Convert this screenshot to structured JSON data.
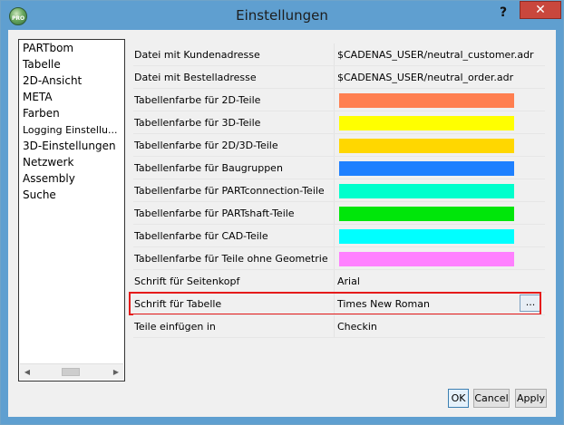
{
  "window": {
    "title": "Einstellungen",
    "help_label": "?",
    "close_label": "✕",
    "icon_text": "PRO"
  },
  "nav": {
    "items": [
      {
        "label": "PARTbom"
      },
      {
        "label": "Tabelle"
      },
      {
        "label": "2D-Ansicht"
      },
      {
        "label": "META"
      },
      {
        "label": "Farben"
      },
      {
        "label": "Logging Einstellu..."
      },
      {
        "label": "3D-Einstellungen"
      },
      {
        "label": "Netzwerk"
      },
      {
        "label": "Assembly"
      },
      {
        "label": "Suche"
      }
    ],
    "scroll_left": "◀",
    "scroll_right": "▶"
  },
  "settings": {
    "rows": [
      {
        "label": "Datei mit Kundenadresse",
        "value": "$CADENAS_USER/neutral_customer.adr"
      },
      {
        "label": "Datei mit Bestelladresse",
        "value": "$CADENAS_USER/neutral_order.adr"
      },
      {
        "label": "Tabellenfarbe für 2D-Teile",
        "color": "#ff7f50"
      },
      {
        "label": "Tabellenfarbe für 3D-Teile",
        "color": "#ffff00"
      },
      {
        "label": "Tabellenfarbe für 2D/3D-Teile",
        "color": "#ffd700"
      },
      {
        "label": "Tabellenfarbe für Baugruppen",
        "color": "#1e80ff"
      },
      {
        "label": "Tabellenfarbe für PARTconnection-Teile",
        "color": "#00ffcc"
      },
      {
        "label": "Tabellenfarbe für PARTshaft-Teile",
        "color": "#00e60a"
      },
      {
        "label": "Tabellenfarbe für CAD-Teile",
        "color": "#00ffff"
      },
      {
        "label": "Tabellenfarbe für Teile ohne Geometrie",
        "color": "#ff80ff"
      },
      {
        "label": "Schrift für Seitenkopf",
        "value": "Arial"
      },
      {
        "label": "Schrift für Tabelle",
        "value": "Times New Roman",
        "button": "..."
      },
      {
        "label": "Teile einfügen in",
        "value": "Checkin"
      }
    ]
  },
  "buttons": {
    "ok": "OK",
    "cancel": "Cancel",
    "apply": "Apply"
  },
  "colors": {
    "highlight": "#e51b1b",
    "titlebar": "#5f9fd0"
  }
}
